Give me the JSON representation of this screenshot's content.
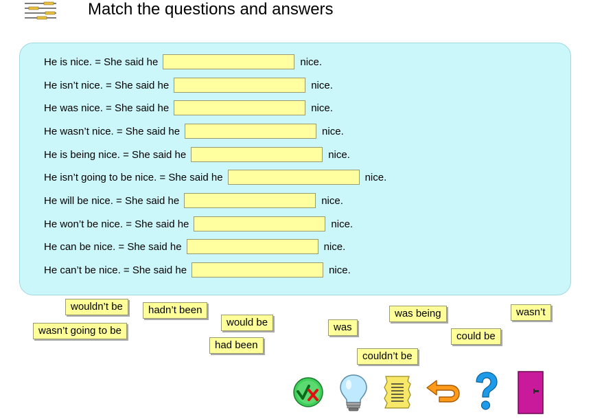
{
  "header": {
    "title": "Match the questions and answers"
  },
  "questions": [
    {
      "prompt": "He is nice. = She said he",
      "tail": "nice."
    },
    {
      "prompt": "He isn’t nice. = She said he",
      "tail": "nice."
    },
    {
      "prompt": "He was nice. = She said he",
      "tail": "nice."
    },
    {
      "prompt": "He wasn’t nice. = She said he",
      "tail": "nice."
    },
    {
      "prompt": "He is being nice. = She said he",
      "tail": "nice."
    },
    {
      "prompt": "He isn’t going to be nice. = She said he",
      "tail": "nice."
    },
    {
      "prompt": "He will be nice. = She said he",
      "tail": "nice."
    },
    {
      "prompt": "He won’t be nice. = She said he",
      "tail": "nice."
    },
    {
      "prompt": "He can be nice. = She said he",
      "tail": "nice."
    },
    {
      "prompt": "He can’t be nice. = She said he",
      "tail": "nice."
    }
  ],
  "answers": [
    "wouldn’t be",
    "hadn’t been",
    "would be",
    "wasn’t going to be",
    "had been",
    "was",
    "was being",
    "wasn’t",
    "could be",
    "couldn’t be"
  ],
  "toolbar": {
    "check_icon": "check-cross-icon",
    "hint_icon": "lightbulb-icon",
    "text_icon": "scroll-icon",
    "restart_icon": "undo-arrow-icon",
    "help_icon": "question-mark-icon",
    "exit_icon": "door-icon"
  }
}
